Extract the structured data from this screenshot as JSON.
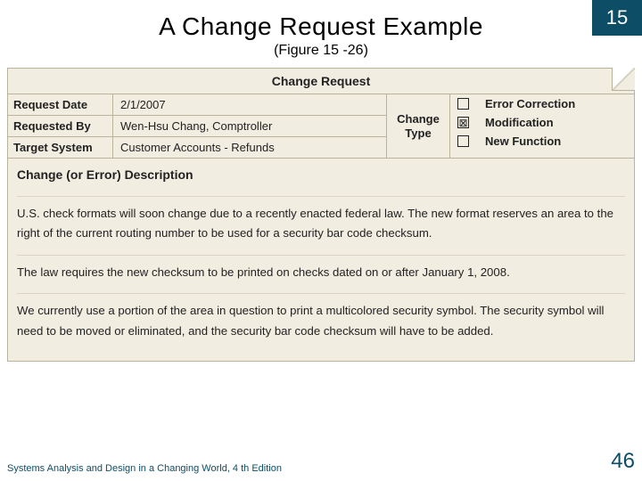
{
  "chapter_number": "15",
  "title": "A Change Request Example",
  "subtitle": "(Figure 15 -26)",
  "figure": {
    "heading": "Change Request",
    "fields": {
      "request_date": {
        "label": "Request Date",
        "value": "2/1/2007"
      },
      "requested_by": {
        "label": "Requested By",
        "value": "Wen-Hsu Chang, Comptroller"
      },
      "target_system": {
        "label": "Target System",
        "value": "Customer Accounts - Refunds"
      }
    },
    "change_type": {
      "label": "Change Type",
      "options": [
        {
          "label": "Error Correction",
          "checked": false
        },
        {
          "label": "Modification",
          "checked": true
        },
        {
          "label": "New Function",
          "checked": false
        }
      ]
    },
    "description": {
      "heading": "Change (or Error) Description",
      "paragraphs": [
        "U.S. check formats will soon change due to a recently enacted federal law. The new format reserves an area to the right of the current routing number to be used for a security bar code checksum.",
        "The law requires the new checksum to be printed on checks dated on or after January 1, 2008.",
        "We currently use a portion of the area in question to print a multicolored security symbol. The security symbol will need to be moved or eliminated, and the security bar code checksum will have to be added."
      ]
    }
  },
  "footer": {
    "source": "Systems Analysis and Design in a Changing World, 4 th Edition",
    "page": "46"
  },
  "glyphs": {
    "checked": "⊠",
    "unchecked": ""
  }
}
